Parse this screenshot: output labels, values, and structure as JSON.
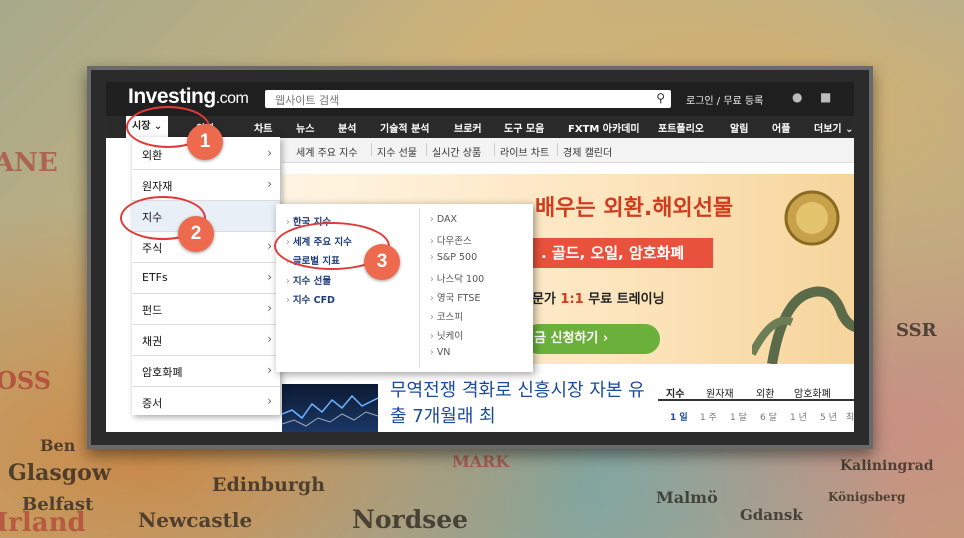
{
  "background_map": {
    "place_names": [
      "Glasgow",
      "Edinburgh",
      "Belfast",
      "Newcastle",
      "Nordsee",
      "Malmö",
      "Kaliningrad",
      "Gdansk",
      "Königsberg",
      "Ben",
      "ANE",
      "OSS",
      "Irland",
      "SSR",
      "MARK"
    ]
  },
  "colors": {
    "topbar": "#1f1f1f",
    "annotation_red": "#e23a3a",
    "badge_orange": "#ee6a4e",
    "link_blue": "#1f3d7a"
  },
  "header": {
    "logo_main": "Investing",
    "logo_suffix": ".com",
    "search_placeholder": "웹사이트 검색",
    "search_icon": "search-icon",
    "login_label": "로그인 / 무료 등록",
    "bell_icon": "bell-icon",
    "bag_icon": "briefcase-icon"
  },
  "nav": {
    "items": [
      "시장",
      "외환",
      "차트",
      "뉴스",
      "분석",
      "기술적 분석",
      "브로커",
      "도구 모음",
      "FXTM 아카데미",
      "포트폴리오",
      "알림",
      "어플",
      "더보기"
    ]
  },
  "subnav": {
    "items": [
      "세계 주요 지수",
      "지수 선물",
      "실시간 상품",
      "라이브 차트",
      "경제 캘린더"
    ]
  },
  "market_menu": {
    "items": [
      "외환",
      "원자재",
      "지수",
      "주식",
      "ETFs",
      "펀드",
      "채권",
      "암호화폐",
      "증서"
    ]
  },
  "indices_flyout": {
    "left": [
      "한국 지수",
      "세계 주요 지수",
      "글로벌 지표",
      "지수 선물",
      "지수 CFD"
    ],
    "right": [
      "DAX",
      "다우존스",
      "S&P 500",
      "나스닥 100",
      "영국 FTSE",
      "코스피",
      "닛케이",
      "VN"
    ]
  },
  "banner": {
    "headline": "배우는 외환.해외선물",
    "ribbon": ". 골드, 오일, 암호화폐",
    "promo_prefix": "전문가",
    "promo_highlight": "1:1",
    "promo_suffix": "무료 트레이닝",
    "cta": "금 신청하기 ›"
  },
  "news": {
    "headline": "무역전쟁 격화로 신흥시장 자본 유출 7개월래 최"
  },
  "quote_tabs": {
    "tabs": [
      "지수",
      "원자재",
      "외환",
      "암호화폐"
    ],
    "periods": [
      "1 일",
      "1 주",
      "1 달",
      "6 달",
      "1 년",
      "5 년",
      "최"
    ]
  },
  "annotations": {
    "step1": "1",
    "step2": "2",
    "step3": "3"
  }
}
